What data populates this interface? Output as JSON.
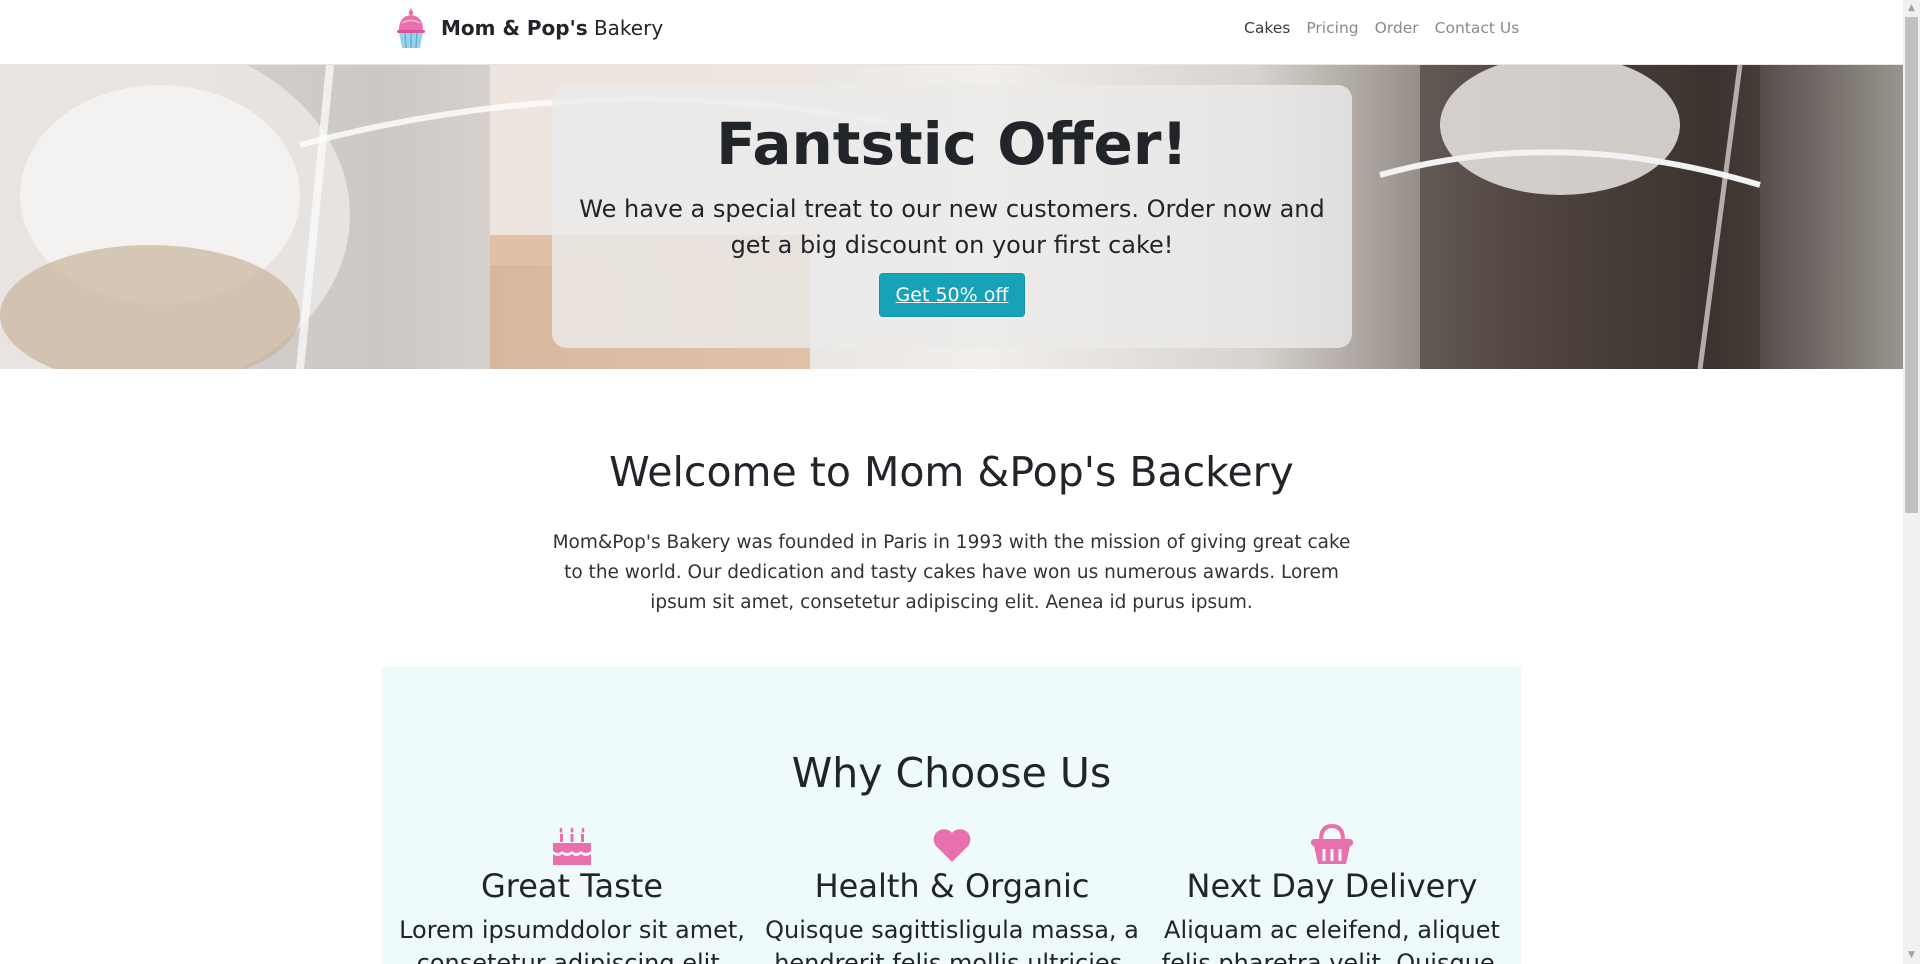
{
  "navbar": {
    "brand_strong": "Mom & Pop's",
    "brand_light": "Bakery",
    "logo_icon": "cupcake-icon",
    "links": [
      {
        "label": "Cakes",
        "active": true
      },
      {
        "label": "Pricing",
        "active": false
      },
      {
        "label": "Order",
        "active": false
      },
      {
        "label": "Contact Us",
        "active": false
      }
    ]
  },
  "hero": {
    "title": "Fantstic Offer!",
    "text": "We have a special treat to our new customers. Order now and get a big discount on your first cake!",
    "button_label": "Get 50% off"
  },
  "welcome": {
    "title": "Welcome to Mom &Pop's Backery",
    "text": "Mom&Pop's Bakery was founded in Paris in 1993 with the mission of giving great cake to the world. Our dedication and tasty cakes have won us numerous awards. Lorem ipsum sit amet, consetetur adipiscing elit. Aenea id purus ipsum."
  },
  "why": {
    "title": "Why Choose Us",
    "features": [
      {
        "icon": "birthday-cake-icon",
        "title": "Great Taste",
        "text": "Lorem ipsumddolor sit amet, consetetur adipiscing elit."
      },
      {
        "icon": "heart-icon",
        "title": "Health & Organic",
        "text": "Quisque sagittisligula massa, a hendrerit felis mollis ultricies."
      },
      {
        "icon": "shopping-basket-icon",
        "title": "Next Day Delivery",
        "text": "Aliquam ac eleifend, aliquet felis pharetra velit. Quisque."
      }
    ]
  },
  "colors": {
    "accent_pink": "#e96fae",
    "button_teal": "#17a2b8",
    "section_bg": "#effafb"
  }
}
